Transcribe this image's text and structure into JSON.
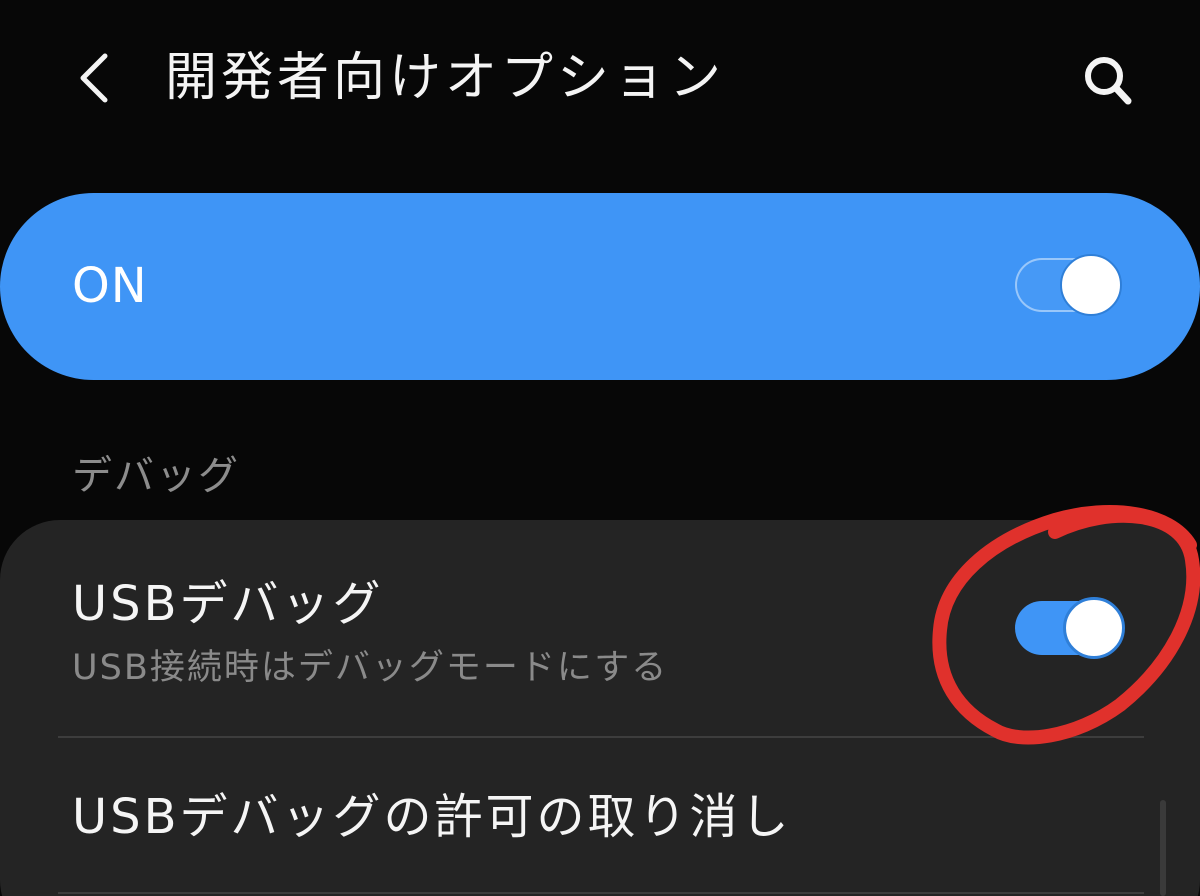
{
  "header": {
    "back_icon": "chevron-left-icon",
    "title": "開発者向けオプション",
    "search_icon": "search-icon"
  },
  "master_switch": {
    "label": "ON",
    "state": "on",
    "color": "#3f95f6"
  },
  "section": {
    "title": "デバッグ"
  },
  "items": [
    {
      "title": "USBデバッグ",
      "subtitle": "USB接続時はデバッグモードにする",
      "toggle_state": "on"
    },
    {
      "title": "USBデバッグの許可の取り消し"
    }
  ],
  "colors": {
    "background": "#070707",
    "card": "#242424",
    "accent": "#3f95f6",
    "annotation": "#e0312c"
  }
}
